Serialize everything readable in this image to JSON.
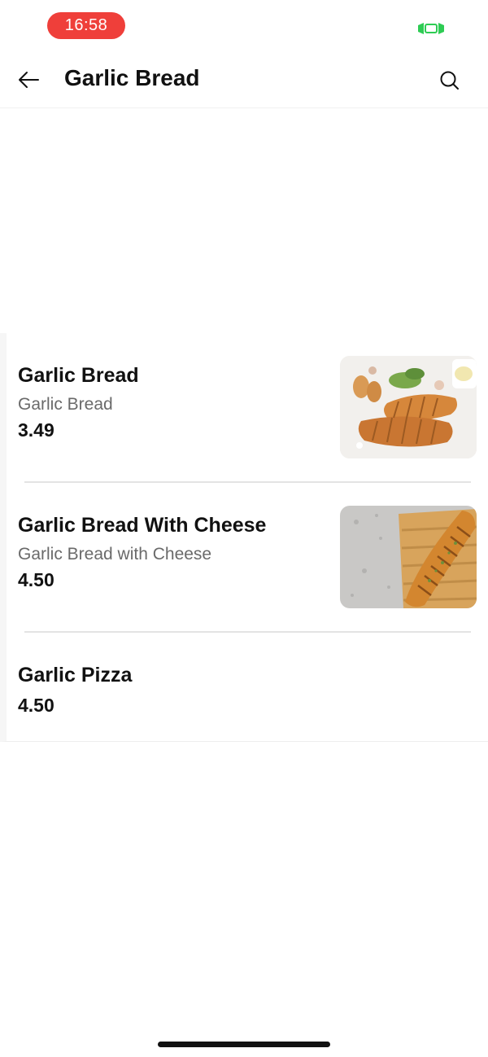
{
  "status_bar": {
    "time": "16:58",
    "accent_color": "#ef3f3a",
    "indicator_color": "#2ecc54"
  },
  "header": {
    "title": "Garlic Bread",
    "back_icon": "arrow-left-icon",
    "search_icon": "search-icon"
  },
  "items": [
    {
      "name": "Garlic Bread",
      "description": "Garlic Bread",
      "price": "3.49",
      "has_image": true
    },
    {
      "name": "Garlic Bread With Cheese",
      "description": "Garlic Bread with Cheese",
      "price": "4.50",
      "has_image": true
    },
    {
      "name": "Garlic Pizza",
      "description": "",
      "price": "4.50",
      "has_image": false
    }
  ]
}
